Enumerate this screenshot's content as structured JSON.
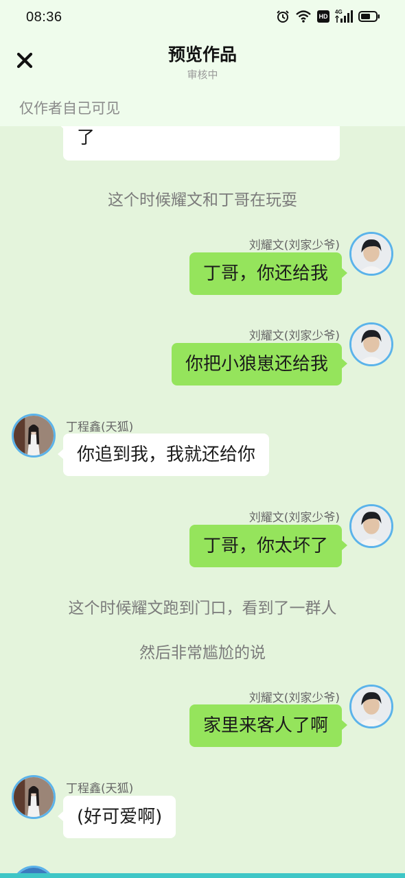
{
  "status_bar": {
    "time": "08:36",
    "hd_label": "HD",
    "network_label": "4G"
  },
  "header": {
    "title": "预览作品",
    "subtitle": "审核中",
    "visibility_note": "仅作者自己可见"
  },
  "chat": {
    "partial_top_text": "了",
    "narration_1": "这个时候耀文和丁哥在玩耍",
    "msg1_sender": "刘耀文(刘家少爷)",
    "msg1_text": "丁哥，你还给我",
    "msg2_sender": "刘耀文(刘家少爷)",
    "msg2_text": "你把小狼崽还给我",
    "msg3_sender": "丁程鑫(天狐)",
    "msg3_text": "你追到我，我就还给你",
    "msg4_sender": "刘耀文(刘家少爷)",
    "msg4_text": "丁哥，你太坏了",
    "narration_2": "这个时候耀文跑到门口，看到了一群人",
    "narration_3": "然后非常尴尬的说",
    "msg5_sender": "刘耀文(刘家少爷)",
    "msg5_text": "家里来客人了啊",
    "msg6_sender": "丁程鑫(天狐)",
    "msg6_text": "(好可爱啊)"
  },
  "colors": {
    "chat_background": "#e4f4dc",
    "header_background": "#effcec",
    "bubble_self": "#95e45c",
    "bubble_other": "#ffffff",
    "avatar_ring": "#5bb3ea"
  }
}
